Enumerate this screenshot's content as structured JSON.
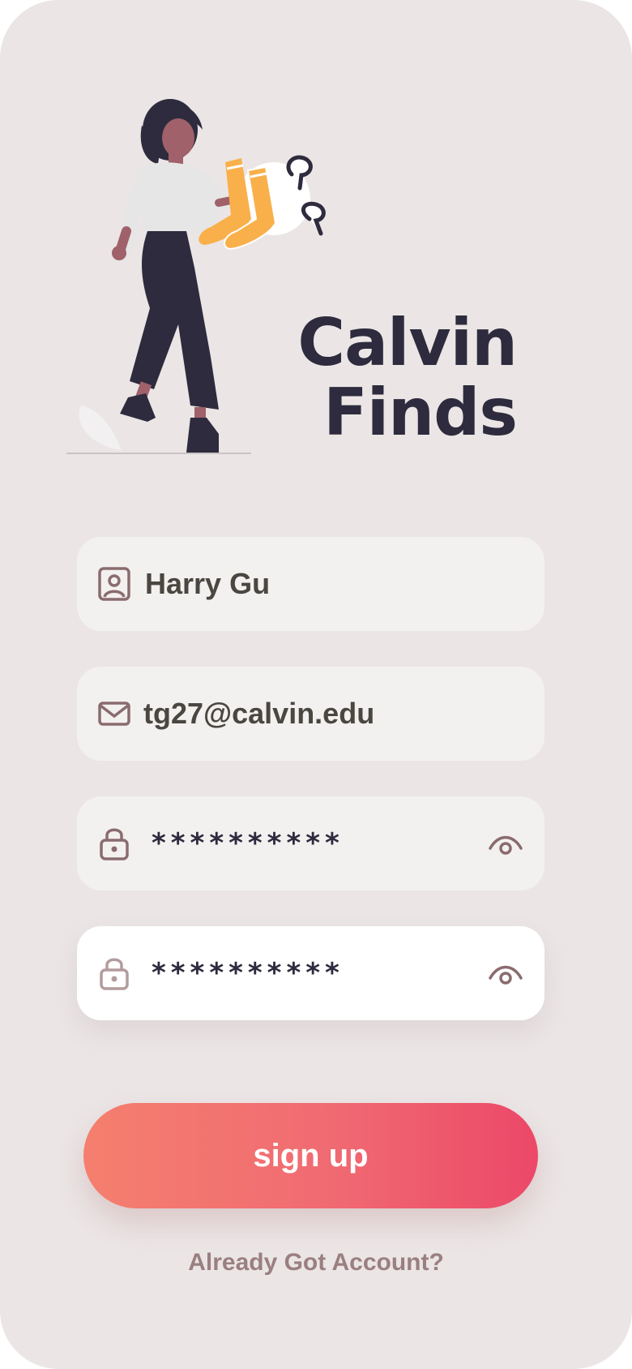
{
  "app": {
    "title_line1": "Calvin",
    "title_line2": "Finds"
  },
  "form": {
    "name_value": "Harry Gu",
    "email_value": "tg27@calvin.edu",
    "password_value": "**********",
    "confirm_password_value": "**********"
  },
  "actions": {
    "signup_label": "sign up",
    "login_link": "Already Got Account?"
  },
  "colors": {
    "background": "#ebe5e5",
    "title": "#2d2b3d",
    "accent_start": "#f57f6e",
    "accent_end": "#ec4868",
    "icon": "#8a6c6e"
  },
  "icons": [
    "user-icon",
    "mail-icon",
    "lock-icon",
    "eye-icon"
  ]
}
